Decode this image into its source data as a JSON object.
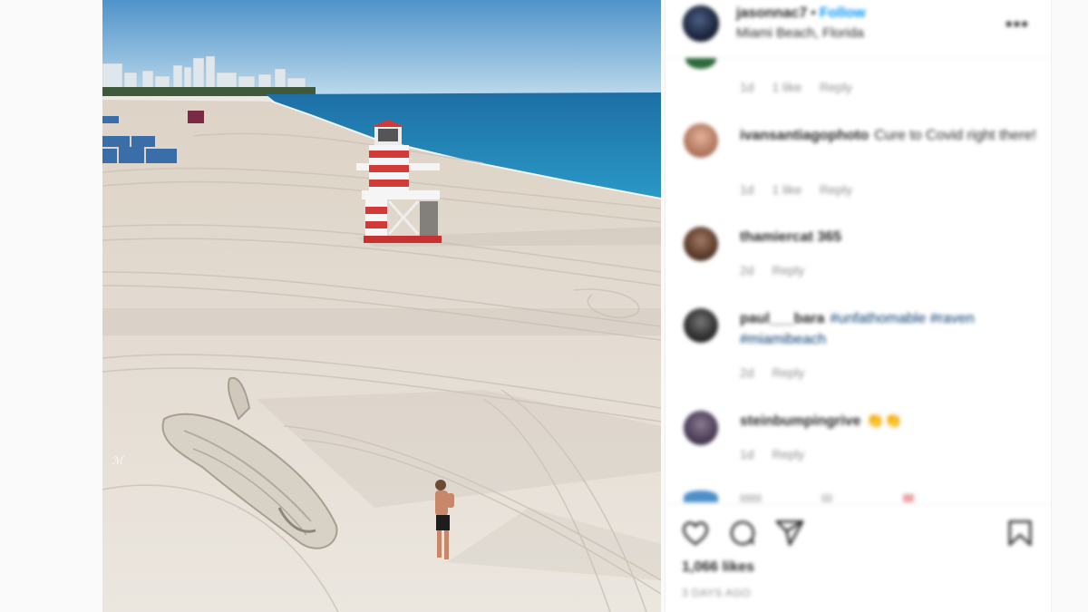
{
  "post": {
    "username": "jasonnac7",
    "separator": "•",
    "follow_label": "Follow",
    "location": "Miami Beach, Florida",
    "more_label": "•••"
  },
  "comments": [
    {
      "user": "",
      "text": "",
      "time": "1d",
      "likes": "1 like",
      "reply": "Reply"
    },
    {
      "user": "ivansantiagophoto",
      "text": "Cure to Covid right there!",
      "time": "1d",
      "likes": "1 like",
      "reply": "Reply"
    },
    {
      "user": "thamiercat 365",
      "text": "",
      "time": "2d",
      "likes": "",
      "reply": "Reply"
    },
    {
      "user": "paul___bara",
      "text": "#unfathomable #raven #miamibeach",
      "time": "2d",
      "likes": "",
      "reply": "Reply"
    },
    {
      "user": "steinbumpingrive",
      "text": "👏👏",
      "time": "1d",
      "likes": "",
      "reply": "Reply"
    }
  ],
  "footer": {
    "likes_count": "1,066 likes",
    "date": "3 DAYS AGO"
  },
  "icons": {
    "like": "heart-icon",
    "comment": "comment-bubble-icon",
    "share": "paper-plane-icon",
    "save": "bookmark-icon",
    "next": "chevron-right-icon"
  },
  "colors": {
    "follow": "#0095f6",
    "hashtag": "#00376b",
    "muted": "#8e8e8e"
  }
}
